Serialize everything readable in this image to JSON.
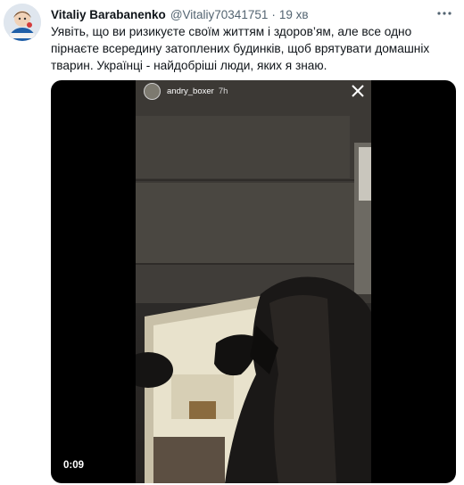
{
  "tweet": {
    "author_name": "Vitaliy Barabanenko",
    "handle": "@Vitaliy70341751",
    "separator": "·",
    "time": "19 хв",
    "text": "Уявіть, що ви ризикуєте своїм життям і здоров’ям, але все одно пірнаєте всередину затоплених будинків, щоб врятувати домашніх тварин. Українці - найдобріші люди, яких я знаю.",
    "more_icon": "more-dots-icon"
  },
  "video": {
    "story_username": "andry_boxer",
    "story_age": "7h",
    "close_icon": "close-icon",
    "duration": "0:09"
  },
  "colors": {
    "name": "#0f1419",
    "meta": "#536471",
    "media_bg": "#000000"
  }
}
